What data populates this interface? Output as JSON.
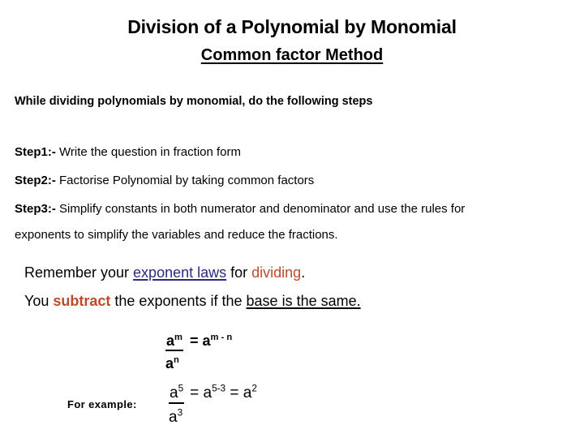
{
  "slide": {
    "background_color": "#ffffff",
    "title": "Division of a Polynomial by Monomial",
    "subtitle": "Common factor Method",
    "intro": "While dividing polynomials by monomial, do the following steps",
    "steps": [
      {
        "label": "Step1:-",
        "text": " Write the question in fraction form"
      },
      {
        "label": "Step2:-",
        "text": " Factorise Polynomial by taking common factors"
      },
      {
        "label": "Step3:-",
        "text": " Simplify constants in both numerator and denominator  and use the rules for",
        "text_line2": "exponents to simplify the variables and reduce the fractions."
      }
    ],
    "remember": {
      "line1_part1": "Remember your ",
      "line1_highlight": "exponent laws",
      "line1_part2": " for ",
      "line1_emphasis": "dividing",
      "line1_part3": ".",
      "line2_part1": "You ",
      "line2_emphasis": "subtract",
      "line2_part2": " the exponents if the ",
      "line2_highlight": "base is the same.",
      "highlight_color": "#2B2B7F",
      "emphasis_color": "#C04A27"
    },
    "example_label": "For example:",
    "formulas": [
      {
        "numerator_base": "a",
        "numerator_exponent": "m",
        "denominator_base": "a",
        "denominator_exponent": "n",
        "equals": "=",
        "result_base": "a",
        "result_exponent": "m - n"
      },
      {
        "numerator_base": "a",
        "numerator_exponent": "5",
        "denominator_base": "a",
        "denominator_exponent": "3",
        "equals_1": "=",
        "middle_base": "a",
        "middle_exponent": "5-3",
        "equals_2": "=",
        "result_base": "a",
        "result_exponent": "2"
      }
    ]
  }
}
